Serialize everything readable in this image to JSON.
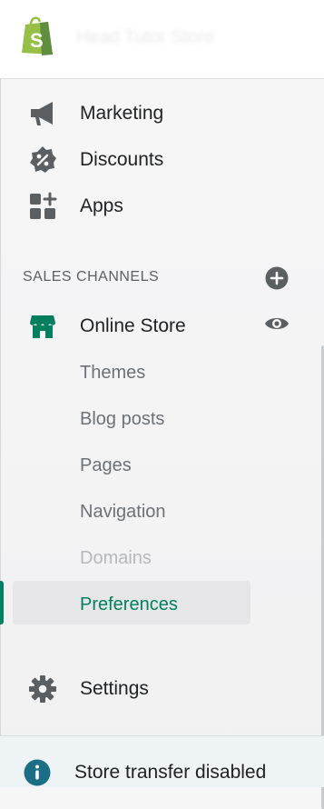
{
  "topbar": {
    "logo": "shopify-bag-logo",
    "store_name": "Head Tutor Store"
  },
  "nav": {
    "items_top": [
      {
        "label": "Marketing",
        "icon": "megaphone-icon"
      },
      {
        "label": "Discounts",
        "icon": "discount-badge-icon"
      },
      {
        "label": "Apps",
        "icon": "apps-grid-icon"
      }
    ],
    "settings": {
      "label": "Settings",
      "icon": "gear-icon"
    }
  },
  "sales_channels": {
    "heading": "SALES CHANNELS",
    "add_icon": "plus-circle-icon",
    "online_store": {
      "label": "Online Store",
      "icon": "storefront-icon",
      "view_icon": "eye-icon"
    },
    "sub_items": [
      "Themes",
      "Blog posts",
      "Pages",
      "Navigation",
      "Domains",
      "Preferences"
    ],
    "active_item": "Preferences",
    "disabled_item": "Domains"
  },
  "banner": {
    "icon": "info-circle-icon",
    "text": "Store transfer disabled"
  },
  "colors": {
    "accent_green": "#007f5f",
    "brand_green": "#95bf47",
    "info_teal": "#1a6e86",
    "icon_gray": "#5c5f62"
  }
}
